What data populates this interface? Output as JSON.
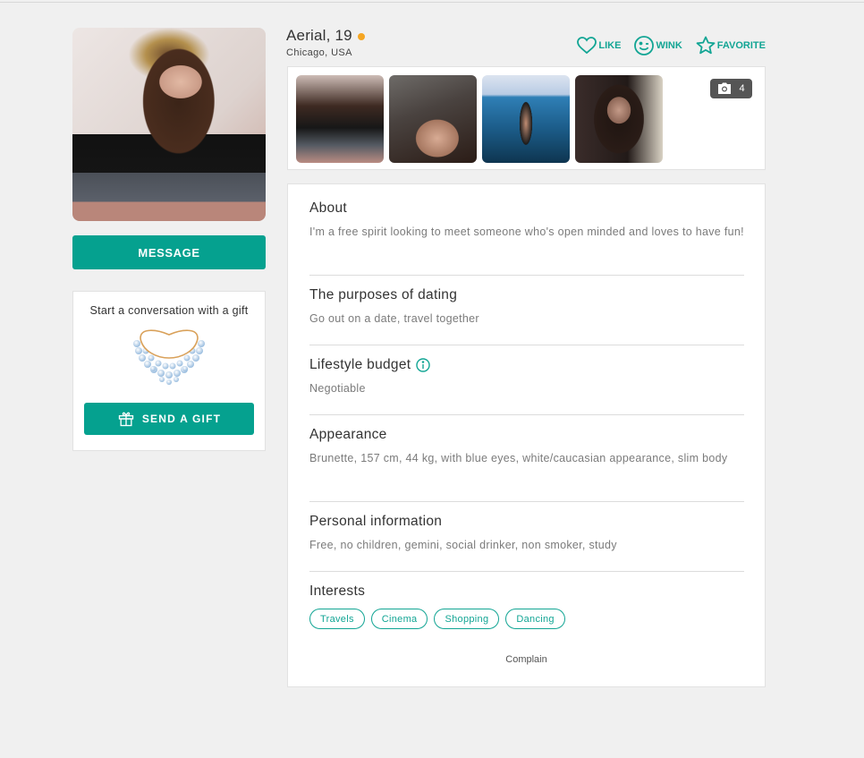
{
  "profile": {
    "name_age": "Aerial, 19",
    "location": "Chicago, USA",
    "online_status_color": "#f5a623",
    "photo_alt": "Profile photo"
  },
  "actions": {
    "like": "LIKE",
    "wink": "WINK",
    "favorite": "FAVORITE"
  },
  "gallery": {
    "photo_count": "4",
    "thumbnails": [
      "Photo 1",
      "Photo 2",
      "Photo 3",
      "Photo 4"
    ]
  },
  "left": {
    "message_label": "MESSAGE",
    "gift_title": "Start a conversation with a gift",
    "gift_button_label": "SEND A GIFT"
  },
  "sections": {
    "about": {
      "title": "About",
      "text": "I'm a free spirit looking to meet someone who's open minded and loves to have fun!"
    },
    "purposes": {
      "title": "The purposes of dating",
      "text": "Go out on a date, travel together"
    },
    "budget": {
      "title": "Lifestyle budget",
      "text": "Negotiable"
    },
    "appearance": {
      "title": "Appearance",
      "text": "Brunette, 157 cm, 44 kg, with blue eyes, white/caucasian appearance, slim body"
    },
    "personal": {
      "title": "Personal information",
      "text": "Free, no children, gemini, social drinker, non smoker, study"
    },
    "interests": {
      "title": "Interests",
      "tags": [
        "Travels",
        "Cinema",
        "Shopping",
        "Dancing"
      ]
    }
  },
  "footer": {
    "complain_label": "Complain"
  },
  "colors": {
    "accent": "#05a18f",
    "accent_text": "#12a594",
    "background": "#f0f0f0"
  }
}
